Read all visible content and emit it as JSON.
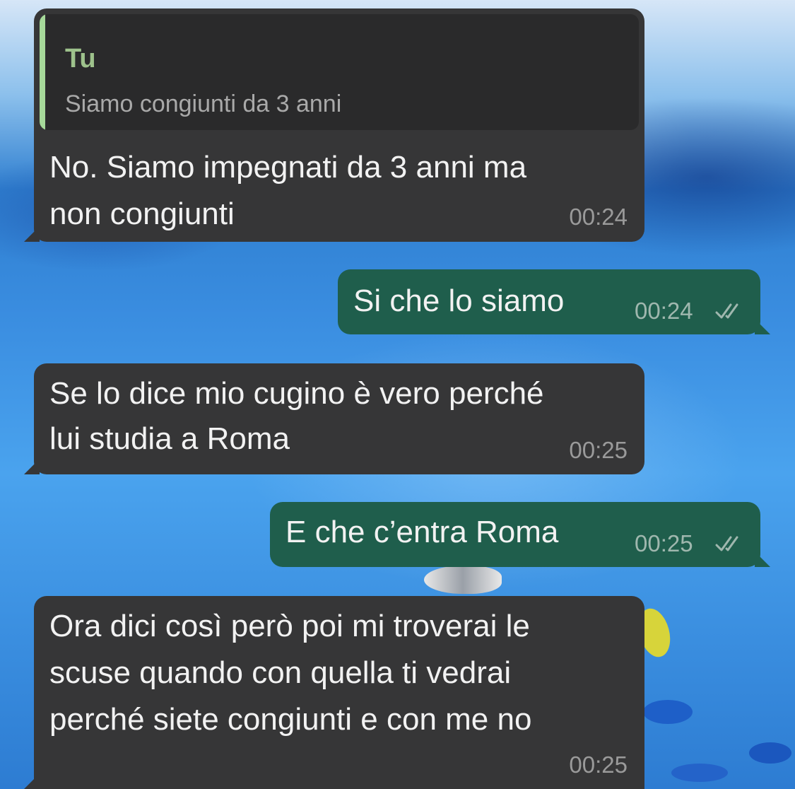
{
  "messages": [
    {
      "direction": "incoming",
      "quote": {
        "sender": "Tu",
        "text": "Siamo congiunti da 3 anni"
      },
      "lines": [
        "No. Siamo impegnati da 3 anni ma",
        "non congiunti"
      ],
      "time": "00:24"
    },
    {
      "direction": "outgoing",
      "lines": [
        "Si che lo siamo"
      ],
      "time": "00:24",
      "status": "read"
    },
    {
      "direction": "incoming",
      "lines": [
        "Se lo dice mio cugino è vero perché",
        "lui studia a Roma"
      ],
      "time": "00:25"
    },
    {
      "direction": "outgoing",
      "lines": [
        "E che c’entra Roma"
      ],
      "time": "00:25",
      "status": "read"
    },
    {
      "direction": "incoming",
      "lines": [
        "Ora dici così però poi mi troverai le",
        "scuse quando con quella ti vedrai",
        "perché siete congiunti e con me no"
      ],
      "time": "00:25"
    }
  ],
  "colors": {
    "incoming_bubble": "#363637",
    "outgoing_bubble": "#1f5e4c",
    "quote_accent": "#a6d99a",
    "read_ticks": "#9fb7ae"
  },
  "icons": {
    "read_receipt": "double-check-icon"
  }
}
